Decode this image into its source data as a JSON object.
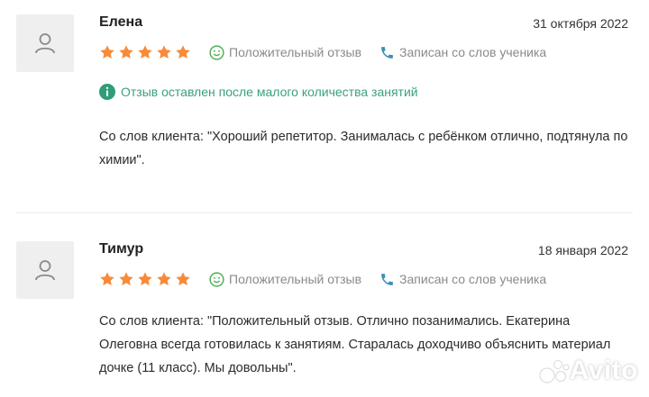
{
  "colors": {
    "star": "#f78b3a",
    "positive_icon": "#4caf50",
    "phone_icon": "#3f8fb5",
    "info_icon": "#2f9d76",
    "muted_text": "#8a8a8a"
  },
  "reviews": [
    {
      "author": "Елена",
      "date": "31 октября 2022",
      "rating": 5,
      "rating_max": 5,
      "sentiment_label": "Положительный отзыв",
      "source_label": "Записан со слов ученика",
      "note": "Отзыв оставлен после малого количества занятий",
      "text": "Со слов клиента: \"Хороший репетитор. Занималась с ребёнком отлично, подтянула по химии\"."
    },
    {
      "author": "Тимур",
      "date": "18 января 2022",
      "rating": 5,
      "rating_max": 5,
      "sentiment_label": "Положительный отзыв",
      "source_label": "Записан со слов ученика",
      "text": "Со слов клиента: \"Положительный отзыв. Отлично позанимались. Екатерина Олеговна всегда готовилась к занятиям. Старалась доходчиво объяснить материал дочке (11 класс). Мы довольны\"."
    }
  ],
  "watermark": {
    "text": "Avito",
    "icon": "avito-logo-icon"
  }
}
